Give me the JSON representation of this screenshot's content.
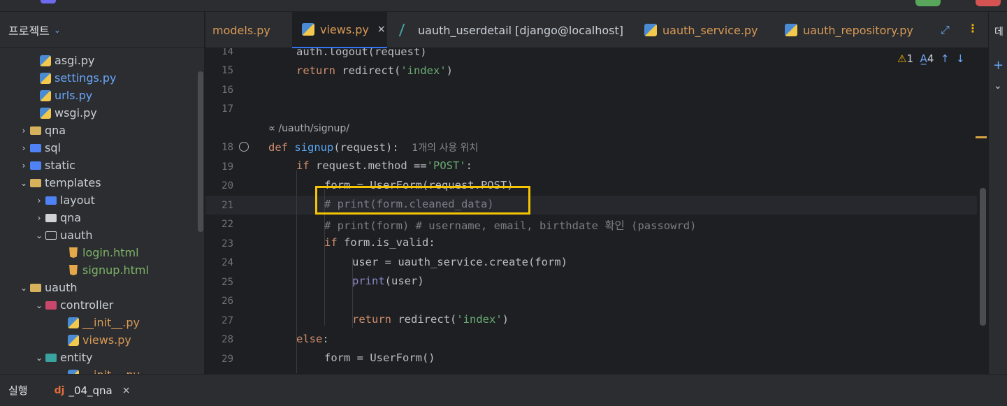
{
  "project_panel": {
    "title": "프로젝트",
    "items": [
      {
        "label": "asgi.py",
        "kind": "py",
        "style": "normal"
      },
      {
        "label": "settings.py",
        "kind": "py",
        "style": "blue"
      },
      {
        "label": "urls.py",
        "kind": "py",
        "style": "blue"
      },
      {
        "label": "wsgi.py",
        "kind": "py",
        "style": "normal"
      },
      {
        "label": "qna",
        "kind": "folder"
      },
      {
        "label": "sql",
        "kind": "folder"
      },
      {
        "label": "static",
        "kind": "folder"
      },
      {
        "label": "templates",
        "kind": "folder"
      },
      {
        "label": "layout",
        "kind": "folder"
      },
      {
        "label": "qna",
        "kind": "folder"
      },
      {
        "label": "uauth",
        "kind": "folder"
      },
      {
        "label": "login.html",
        "kind": "html"
      },
      {
        "label": "signup.html",
        "kind": "html"
      },
      {
        "label": "uauth",
        "kind": "folder"
      },
      {
        "label": "controller",
        "kind": "folder"
      },
      {
        "label": "__init__.py",
        "kind": "py"
      },
      {
        "label": "views.py",
        "kind": "py"
      },
      {
        "label": "entity",
        "kind": "folder"
      },
      {
        "label": "__init__.py",
        "kind": "py"
      }
    ]
  },
  "tabs": [
    {
      "label": "models.py",
      "active": false
    },
    {
      "label": "views.py",
      "active": true
    },
    {
      "label": "uauth_userdetail [django@localhost]",
      "active": false
    },
    {
      "label": "uauth_service.py",
      "active": false
    },
    {
      "label": "uauth_repository.py",
      "active": false
    }
  ],
  "tab_close": "×",
  "right_strip": {
    "label": "데"
  },
  "editor": {
    "line_numbers": [
      "14",
      "15",
      "16",
      "17",
      "18",
      "19",
      "20",
      "21",
      "22",
      "23",
      "24",
      "25",
      "26",
      "27",
      "28",
      "29"
    ],
    "route_hint": "/uauth/signup/",
    "usage_hint": "1개의 사용 위치",
    "warnings": {
      "warn_count": "1",
      "spell_count": "4"
    },
    "lines": {
      "l14": "auth.logout(request)",
      "l15_kw": "return",
      "l15_rest": " redirect(",
      "l15_str": "'index'",
      "l15_end": ")",
      "l18_kw": "def",
      "l18_fn": "signup",
      "l18_rest": "(request):",
      "l19_kw": "if",
      "l19_rest": " request.method ==",
      "l19_str": "'POST'",
      "l19_end": ":",
      "l20": "form = UserForm(request.POST)",
      "l21": "# print(form.cleaned_data)",
      "l22": "# print(form) # username, email, birthdate 확인 (passowrd)",
      "l23_kw": "if",
      "l23_rest": " form.is_valid:",
      "l24": "user = uauth_service.create(form)",
      "l25_fn": "print",
      "l25_rest": "(user)",
      "l27_kw": "return",
      "l27_rest": " redirect(",
      "l27_str": "'index'",
      "l27_end": ")",
      "l28_kw": "else",
      "l28_end": ":",
      "l29": "form = UserForm()"
    }
  },
  "run_bar": {
    "label": "실행",
    "dj_icon": "dj",
    "config": "_04_qna",
    "close": "×"
  },
  "colors": {
    "accent": "#3574f0",
    "highlight_box": "#f5c400",
    "background": "#1e1f22",
    "panel": "#2b2d30"
  }
}
